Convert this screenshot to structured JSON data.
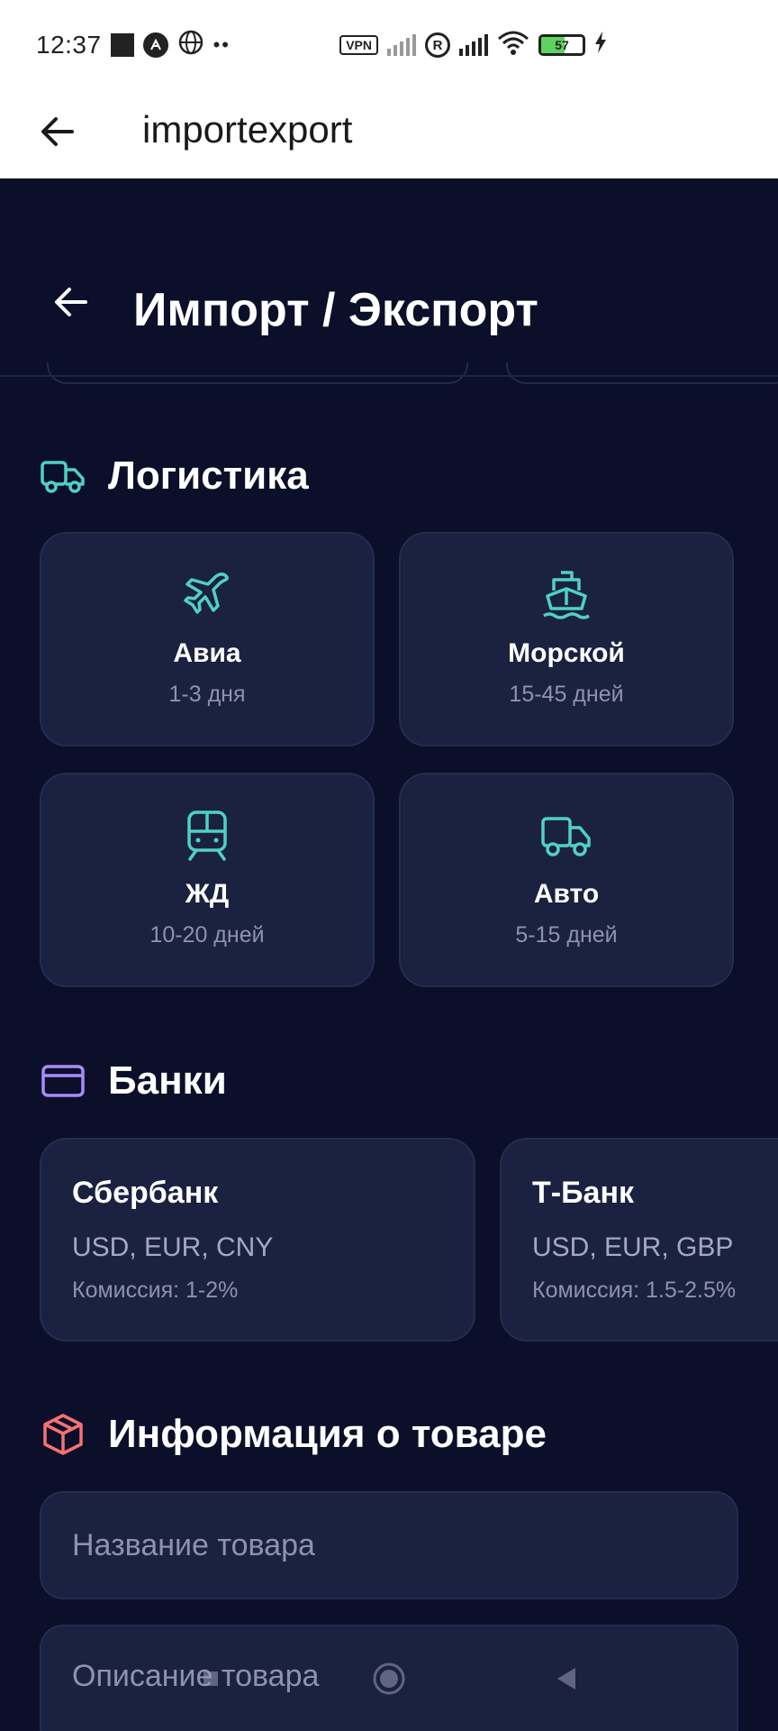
{
  "status_bar": {
    "time": "12:37",
    "vpn": "VPN",
    "roaming": "R",
    "battery": "57",
    "battery_level": 0.57
  },
  "app_bar": {
    "title": "importexport"
  },
  "header": {
    "title": "Импорт / Экспорт"
  },
  "logistics": {
    "title": "Логистика",
    "accent": "#4fd1c5",
    "items": [
      {
        "name": "Авиа",
        "time": "1-3 дня",
        "icon": "plane-icon"
      },
      {
        "name": "Морской",
        "time": "15-45 дней",
        "icon": "ship-icon"
      },
      {
        "name": "ЖД",
        "time": "10-20 дней",
        "icon": "train-icon"
      },
      {
        "name": "Авто",
        "time": "5-15 дней",
        "icon": "truck-icon"
      }
    ]
  },
  "banks": {
    "title": "Банки",
    "accent": "#a78bfa",
    "items": [
      {
        "name": "Сбербанк",
        "currencies": "USD, EUR, CNY",
        "fee": "Комиссия: 1-2%"
      },
      {
        "name": "Т-Банк",
        "currencies": "USD, EUR, GBP",
        "fee": "Комиссия: 1.5-2.5%"
      }
    ]
  },
  "product": {
    "title": "Информация о товаре",
    "accent": "#f87171",
    "name_placeholder": "Название товара",
    "description_placeholder": "Описание товара"
  },
  "colors": {
    "background": "#0b0f2a",
    "card": "#1b2140",
    "card_border": "#252c4f",
    "muted_text": "#8d93ae"
  }
}
